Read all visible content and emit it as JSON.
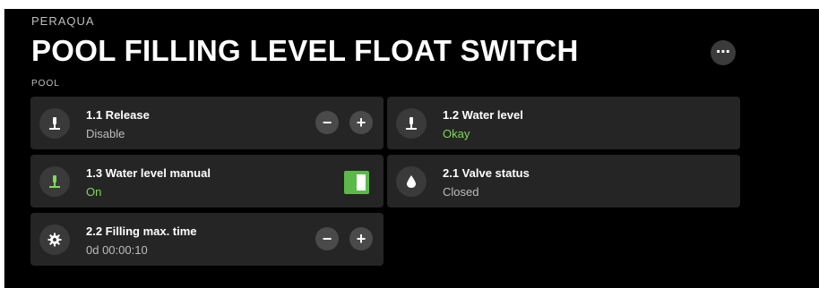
{
  "header": {
    "brand": "PERAQUA",
    "title": "POOL FILLING LEVEL FLOAT SWITCH",
    "subtitle": "POOL",
    "more_label": "⋯"
  },
  "tiles": [
    {
      "label": "1.1 Release",
      "value": "Disable",
      "icon": "float-switch-icon",
      "controls": [
        "−",
        "+"
      ]
    },
    {
      "label": "1.2 Water level",
      "value": "Okay",
      "icon": "float-switch-icon"
    },
    {
      "label": "1.3 Water level manual",
      "value": "On",
      "icon": "float-switch-icon",
      "toggle_state": "on"
    },
    {
      "label": "2.1 Valve status",
      "value": "Closed",
      "icon": "water-drop-icon"
    },
    {
      "label": "2.2 Filling max. time",
      "value": "0d 00:00:10",
      "icon": "gear-icon",
      "controls": [
        "−",
        "+"
      ]
    }
  ],
  "colors": {
    "background": "#000000",
    "tile": "#252525",
    "accent_green": "#7ed957",
    "toggle_green": "#5bb94a"
  }
}
